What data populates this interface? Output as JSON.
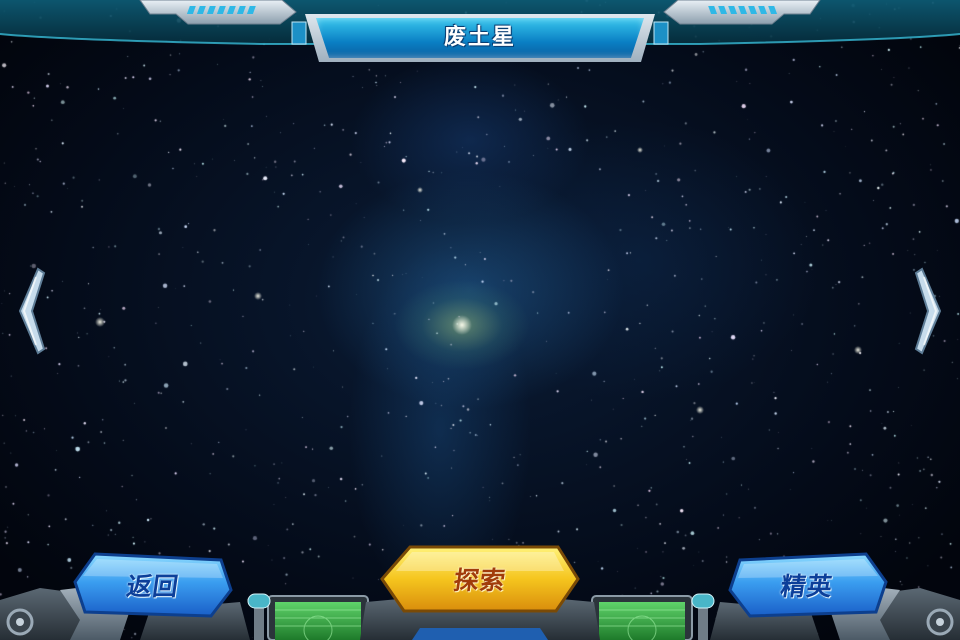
{
  "screen": {
    "planet_name": "废土星"
  },
  "navigation": {
    "prev_icon": "chevron-left-icon",
    "next_icon": "chevron-right-icon"
  },
  "buttons": {
    "back_label": "返回",
    "explore_label": "探索",
    "elite_label": "精英"
  },
  "colors": {
    "title_blue": "#1a9ad8",
    "button_blue": "#2f8fe8",
    "button_gold": "#f5c51e",
    "frame_steel": "#b8c6d2",
    "screen_green": "#3fae4a"
  }
}
